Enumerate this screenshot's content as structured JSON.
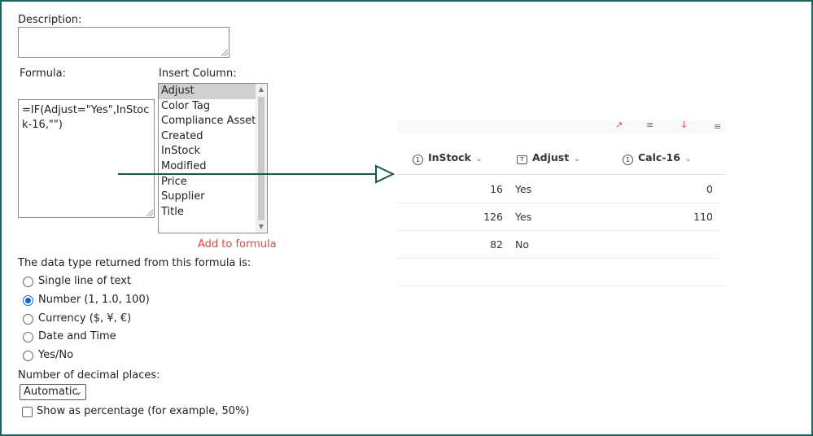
{
  "form": {
    "description_label": "Description:",
    "description_value": "",
    "formula_label": "Formula:",
    "formula_value": "=IF(Adjust=\"Yes\",InStock-16,\"\")",
    "insert_column_label": "Insert Column:",
    "columns": [
      "Adjust",
      "Color Tag",
      "Compliance Asset Id",
      "Created",
      "InStock",
      "Modified",
      "Price",
      "Supplier",
      "Title"
    ],
    "selected_column": "Adjust",
    "add_to_formula": "Add to formula",
    "return_type_label": "The data type returned from this formula is:",
    "return_types": [
      "Single line of text",
      "Number (1, 1.0, 100)",
      "Currency ($, ¥, €)",
      "Date and Time",
      "Yes/No"
    ],
    "selected_return_type": "Number (1, 1.0, 100)",
    "decimal_places_label": "Number of decimal places:",
    "decimal_places_value": "Automatic",
    "show_percentage_label": "Show as percentage (for example, 50%)",
    "show_percentage_checked": false
  },
  "list_view": {
    "columns": [
      {
        "name": "InStock",
        "type_icon": "number-icon"
      },
      {
        "name": "Adjust",
        "type_icon": "text-icon"
      },
      {
        "name": "Calc-16",
        "type_icon": "number-icon"
      }
    ],
    "rows": [
      {
        "instock": "16",
        "adjust": "Yes",
        "calc": "0"
      },
      {
        "instock": "126",
        "adjust": "Yes",
        "calc": "110"
      },
      {
        "instock": "82",
        "adjust": "No",
        "calc": ""
      }
    ]
  },
  "colors": {
    "frame_border": "#0f6b60",
    "arrow": "#0f5a52",
    "link_red": "#e0463c",
    "radio_blue": "#0a64d8"
  }
}
